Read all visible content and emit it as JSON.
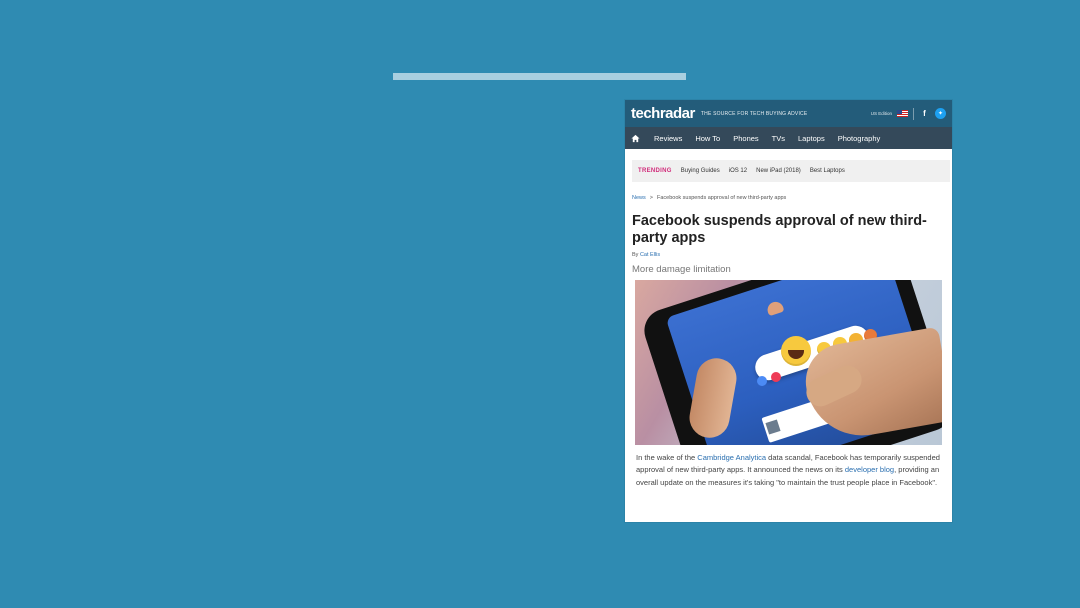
{
  "site": {
    "logo": "techradar",
    "tagline": "THE SOURCE FOR TECH BUYING ADVICE",
    "edition": "US Edition",
    "social_icons": [
      "facebook-icon",
      "twitter-icon"
    ]
  },
  "nav": {
    "items": [
      "Reviews",
      "How To",
      "Phones",
      "TVs",
      "Laptops",
      "Photography"
    ]
  },
  "trending": {
    "label": "TRENDING",
    "items": [
      "Buying Guides",
      "iOS 12",
      "New iPad (2018)",
      "Best Laptops"
    ]
  },
  "breadcrumb": {
    "section": "News",
    "separator": ">",
    "current": "Facebook suspends approval of new third-party apps"
  },
  "article": {
    "title": "Facebook suspends approval of new third-party apps",
    "byline_prefix": "By ",
    "author": "Cat Ellis",
    "subtitle": "More damage limitation",
    "body": {
      "p1": "In the wake of the ",
      "link1": "Cambridge Analytica",
      "p2": " data scandal, Facebook has temporarily suspended approval of new third-party apps. It announced the news on its ",
      "link2": "developer blog",
      "p3": ", providing an overall update on the measures it's taking \"to maintain the trust people place in Facebook\"."
    }
  },
  "colors": {
    "background": "#2f8bb2",
    "accent_line": "#a9cfe0",
    "brand_bar": "#235c7a",
    "nav_bar": "#34495a",
    "trending_label": "#d12b7a",
    "link": "#2a6fb0"
  }
}
